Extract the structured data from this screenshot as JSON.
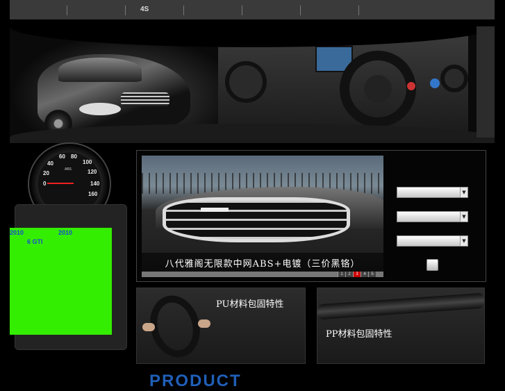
{
  "nav": {
    "items": [
      "",
      "",
      "4S",
      "",
      "",
      "",
      ""
    ]
  },
  "speedometer": {
    "ticks": [
      "60",
      "80",
      "100",
      "40",
      "120",
      "20",
      "140",
      "0",
      "160"
    ],
    "label": "ABS"
  },
  "promo": {
    "line1_left": "2010",
    "line1_right": "2010",
    "line2": "6 GTI",
    "background_color": "#33ee00"
  },
  "gallery": {
    "caption": "八代雅阁无限款中网ABS+电镀（三价黑铬）",
    "pages": [
      "1",
      "2",
      "3",
      "4",
      "5"
    ],
    "active_page": "3"
  },
  "search": {
    "select1": "",
    "select2": "",
    "select3": "",
    "submit_label": ""
  },
  "features": {
    "pu_label": "PU材料包固特性",
    "pp_label": "PP材料包固特性"
  },
  "footer": {
    "title_partial": "PRODUCT"
  }
}
